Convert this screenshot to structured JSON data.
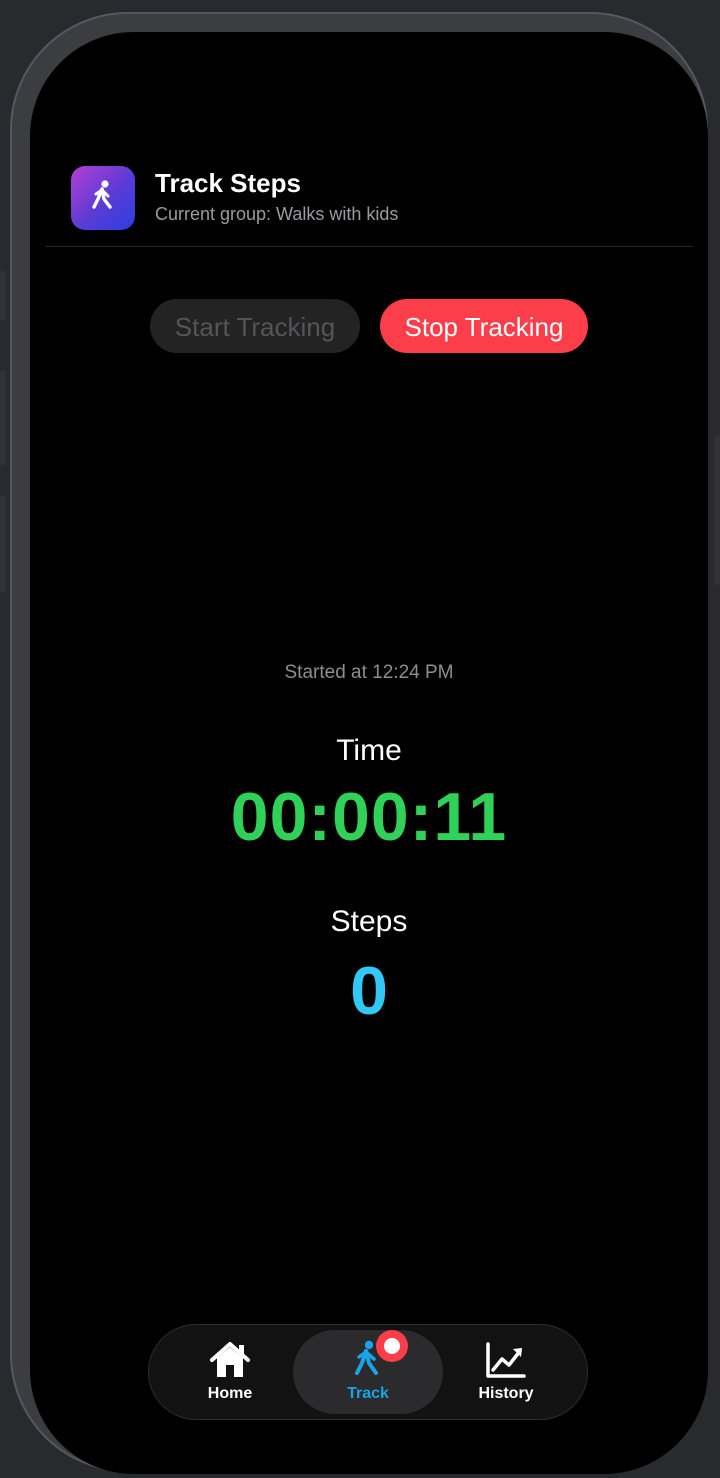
{
  "header": {
    "title": "Track Steps",
    "subtitle": "Current group: Walks with kids",
    "icon": "walking-figure-icon"
  },
  "controls": {
    "start_label": "Start Tracking",
    "stop_label": "Stop Tracking"
  },
  "session": {
    "started_text": "Started at 12:24 PM",
    "time_label": "Time",
    "time_value": "00:00:11",
    "steps_label": "Steps",
    "steps_value": "0"
  },
  "tabs": [
    {
      "label": "Home",
      "icon": "house-icon",
      "active": false
    },
    {
      "label": "Track",
      "icon": "walking-figure-icon",
      "active": true,
      "badge": "recording-dot"
    },
    {
      "label": "History",
      "icon": "chart-line-up-icon",
      "active": false
    }
  ],
  "colors": {
    "stop_button": "#fc3d4a",
    "time_value": "#30d158",
    "steps_value": "#32c8f5",
    "active_tab": "#1aa3e8"
  }
}
